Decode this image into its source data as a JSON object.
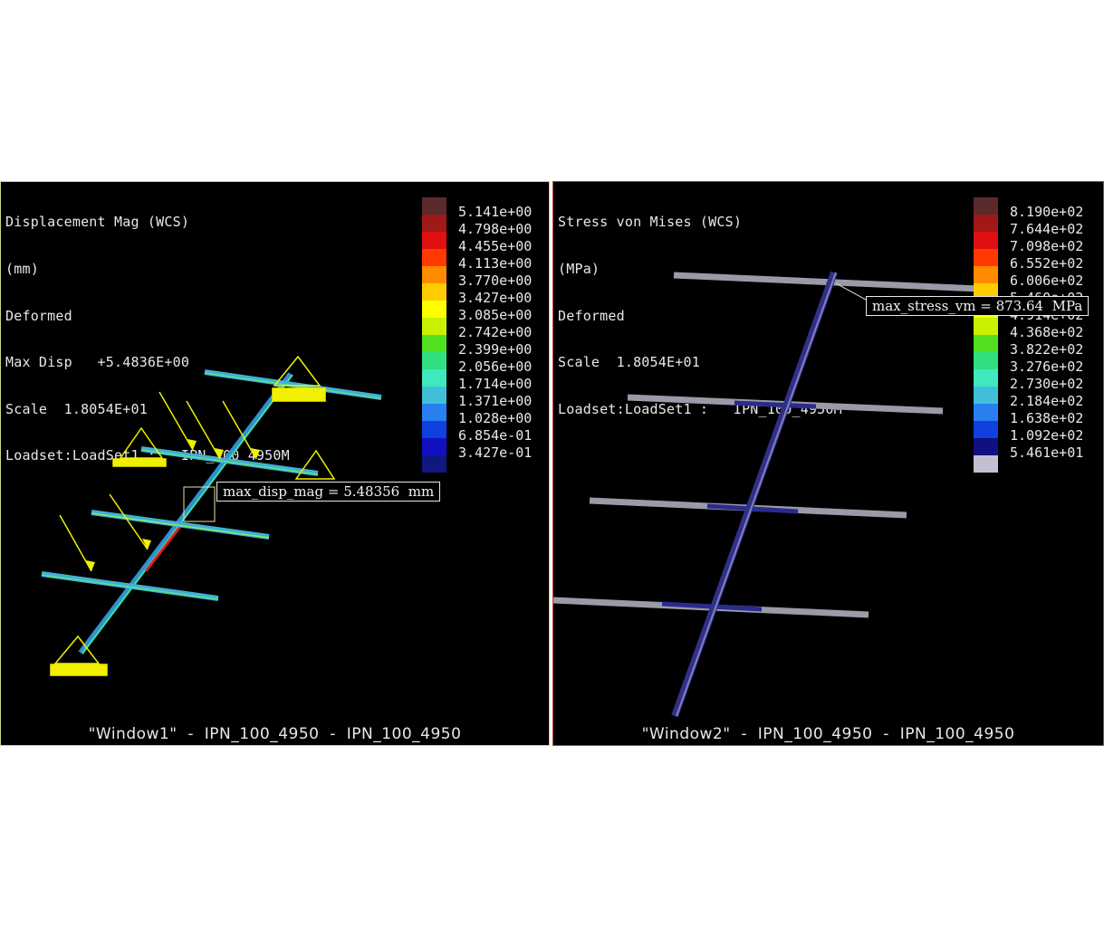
{
  "left_window": {
    "info_lines": [
      "Displacement Mag (WCS)",
      "(mm)",
      "Deformed",
      "Max Disp   +5.4836E+00",
      "Scale  1.8054E+01",
      "Loadset:LoadSet1 :   IPN_100_4950M"
    ],
    "legend_values": [
      "5.141e+00",
      "4.798e+00",
      "4.455e+00",
      "4.113e+00",
      "3.770e+00",
      "3.427e+00",
      "3.085e+00",
      "2.742e+00",
      "2.399e+00",
      "2.056e+00",
      "1.714e+00",
      "1.371e+00",
      "1.028e+00",
      "6.854e-01",
      "3.427e-01"
    ],
    "legend_colors": [
      "#5a2a2a",
      "#a01818",
      "#e01010",
      "#ff3a00",
      "#ff8a00",
      "#ffcc00",
      "#ffff00",
      "#c8f000",
      "#50e020",
      "#30e080",
      "#40e8c0",
      "#40c0d8",
      "#2880f0",
      "#1040e0",
      "#1010c0",
      "#101880"
    ],
    "probe_label": "max_disp_mag = 5.48356  mm",
    "caption": "\"Window1\"  -  IPN_100_4950  -  IPN_100_4950"
  },
  "right_window": {
    "info_lines": [
      "Stress von Mises (WCS)",
      "(MPa)",
      "Deformed",
      "Scale  1.8054E+01",
      "Loadset:LoadSet1 :   IPN_100_4950M"
    ],
    "legend_values": [
      "8.190e+02",
      "7.644e+02",
      "7.098e+02",
      "6.552e+02",
      "6.006e+02",
      "5.460e+02",
      "4.914e+02",
      "4.368e+02",
      "3.822e+02",
      "3.276e+02",
      "2.730e+02",
      "2.184e+02",
      "1.638e+02",
      "1.092e+02",
      "5.461e+01"
    ],
    "legend_colors": [
      "#5a2a2a",
      "#a01818",
      "#e01010",
      "#ff3a00",
      "#ff8a00",
      "#ffcc00",
      "#ffff00",
      "#c8f000",
      "#50e020",
      "#30e080",
      "#40e8c0",
      "#40c0d8",
      "#2880f0",
      "#1040e0",
      "#101080",
      "#c0c0d0"
    ],
    "probe_label": "max_stress_vm = 873.64  MPa",
    "caption": "\"Window2\"  -  IPN_100_4950  -  IPN_100_4950"
  }
}
